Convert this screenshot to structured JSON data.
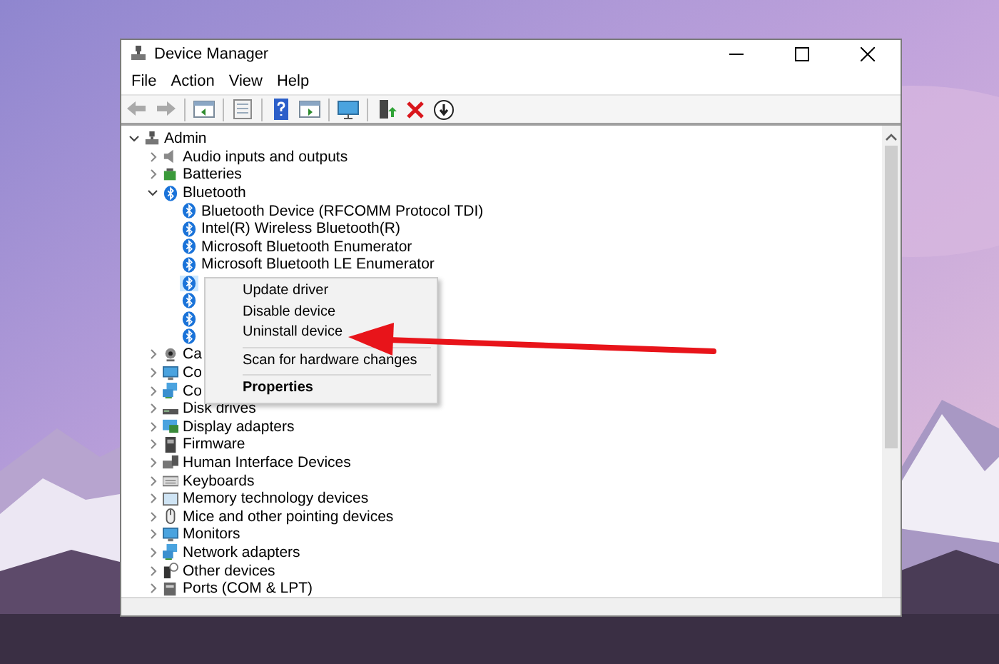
{
  "window": {
    "title": "Device Manager"
  },
  "menu_bar": [
    "File",
    "Action",
    "View",
    "Help"
  ],
  "toolbar": [
    {
      "kind": "back",
      "disabled": true
    },
    {
      "kind": "forward",
      "disabled": true
    },
    {
      "kind": "sep"
    },
    {
      "kind": "panel"
    },
    {
      "kind": "sep"
    },
    {
      "kind": "sheet"
    },
    {
      "kind": "sep"
    },
    {
      "kind": "help"
    },
    {
      "kind": "panel2"
    },
    {
      "kind": "sep"
    },
    {
      "kind": "monitor"
    },
    {
      "kind": "sep"
    },
    {
      "kind": "update"
    },
    {
      "kind": "remove"
    },
    {
      "kind": "download"
    }
  ],
  "tree": [
    {
      "label": "Admin",
      "kind": "computer",
      "expanded": true,
      "children": [
        {
          "label": "Audio inputs and outputs",
          "kind": "audio",
          "expanded": false
        },
        {
          "label": "Batteries",
          "kind": "battery",
          "expanded": false
        },
        {
          "label": "Bluetooth",
          "kind": "bluetooth",
          "expanded": true,
          "children": [
            {
              "label": "Bluetooth Device (RFCOMM Protocol TDI)",
              "kind": "bluetooth",
              "selected": false
            },
            {
              "label": "Intel(R) Wireless Bluetooth(R)",
              "kind": "bluetooth",
              "selected": false
            },
            {
              "label": "Microsoft Bluetooth Enumerator",
              "kind": "bluetooth",
              "selected": false
            },
            {
              "label": "Microsoft Bluetooth LE Enumerator",
              "kind": "bluetooth",
              "selected": false
            },
            {
              "kind": "bluetooth",
              "selected": true
            },
            {
              "kind": "bluetooth",
              "selected": false
            },
            {
              "kind": "bluetooth",
              "selected": false
            },
            {
              "kind": "bluetooth",
              "selected": false
            }
          ]
        },
        {
          "label": "Ca",
          "kind": "camera",
          "expanded": false
        },
        {
          "label": "Co",
          "kind": "monitor",
          "expanded": false
        },
        {
          "label": "Co",
          "kind": "network",
          "expanded": false
        },
        {
          "label": "Disk drives",
          "kind": "disk",
          "expanded": false
        },
        {
          "label": "Display adapters",
          "kind": "display",
          "expanded": false
        },
        {
          "label": "Firmware",
          "kind": "firmware",
          "expanded": false
        },
        {
          "label": "Human Interface Devices",
          "kind": "hid",
          "expanded": false
        },
        {
          "label": "Keyboards",
          "kind": "keyboard",
          "expanded": false
        },
        {
          "label": "Memory technology devices",
          "kind": "memory",
          "expanded": false
        },
        {
          "label": "Mice and other pointing devices",
          "kind": "mouse",
          "expanded": false
        },
        {
          "label": "Monitors",
          "kind": "monitor",
          "expanded": false
        },
        {
          "label": "Network adapters",
          "kind": "network",
          "expanded": false
        },
        {
          "label": "Other devices",
          "kind": "other",
          "expanded": false
        },
        {
          "label": "Ports (COM & LPT)",
          "kind": "port",
          "expanded": false
        }
      ]
    }
  ],
  "context_menu": [
    {
      "kind": "item",
      "label": "Update driver",
      "default": false
    },
    {
      "kind": "item",
      "label": "Disable device",
      "default": false
    },
    {
      "kind": "item",
      "label": "Uninstall device",
      "default": false
    },
    {
      "kind": "separator"
    },
    {
      "kind": "item",
      "label": "Scan for hardware changes",
      "default": false
    },
    {
      "kind": "separator"
    },
    {
      "kind": "item",
      "label": "Properties",
      "default": true
    }
  ]
}
